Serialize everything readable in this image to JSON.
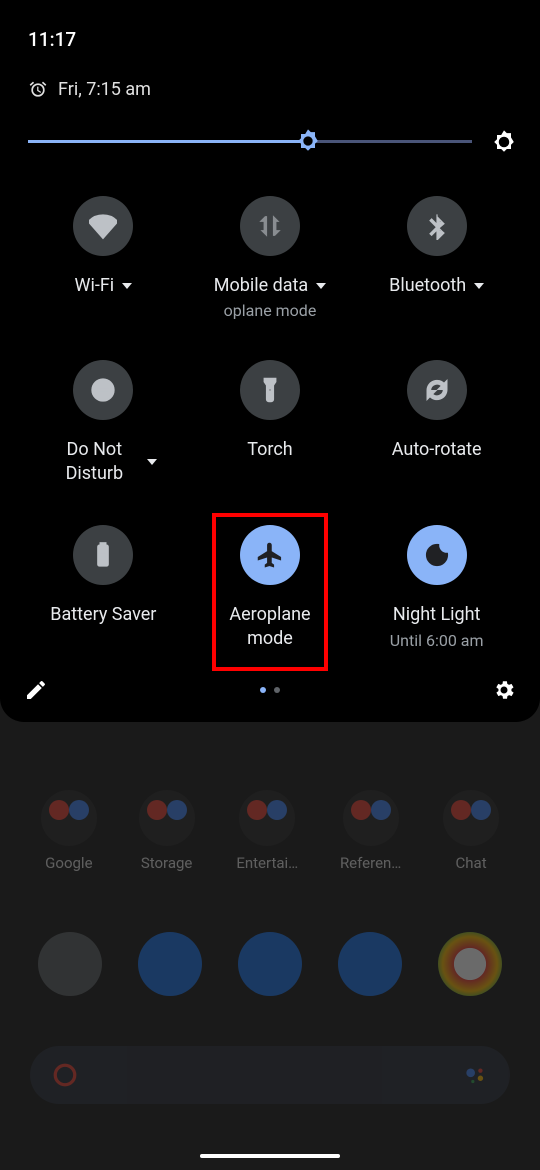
{
  "status": {
    "time": "11:17"
  },
  "alarm": {
    "label": "Fri, 7:15 am"
  },
  "brightness": {
    "percent": 63
  },
  "tiles": [
    {
      "label": "Wi-Fi",
      "sublabel": "",
      "active": false,
      "dropdown": true
    },
    {
      "label": "Mobile data",
      "sublabel": "oplane mode",
      "active": false,
      "dropdown": true
    },
    {
      "label": "Bluetooth",
      "sublabel": "",
      "active": false,
      "dropdown": true
    },
    {
      "label": "Do Not Disturb",
      "sublabel": "",
      "active": false,
      "dropdown": true
    },
    {
      "label": "Torch",
      "sublabel": "",
      "active": false,
      "dropdown": false
    },
    {
      "label": "Auto-rotate",
      "sublabel": "",
      "active": false,
      "dropdown": false
    },
    {
      "label": "Battery Saver",
      "sublabel": "",
      "active": false,
      "dropdown": false
    },
    {
      "label": "Aeroplane mode",
      "sublabel": "",
      "active": true,
      "dropdown": false,
      "highlighted": true
    },
    {
      "label": "Night Light",
      "sublabel": "Until 6:00 am",
      "active": true,
      "dropdown": false
    }
  ],
  "home": {
    "folders": [
      "Google",
      "Storage",
      "Entertai…",
      "Referen…",
      "Chat"
    ]
  },
  "colors": {
    "accent": "#8ab4f8",
    "tile_off": "#3c4043",
    "highlight": "#ff0000"
  }
}
